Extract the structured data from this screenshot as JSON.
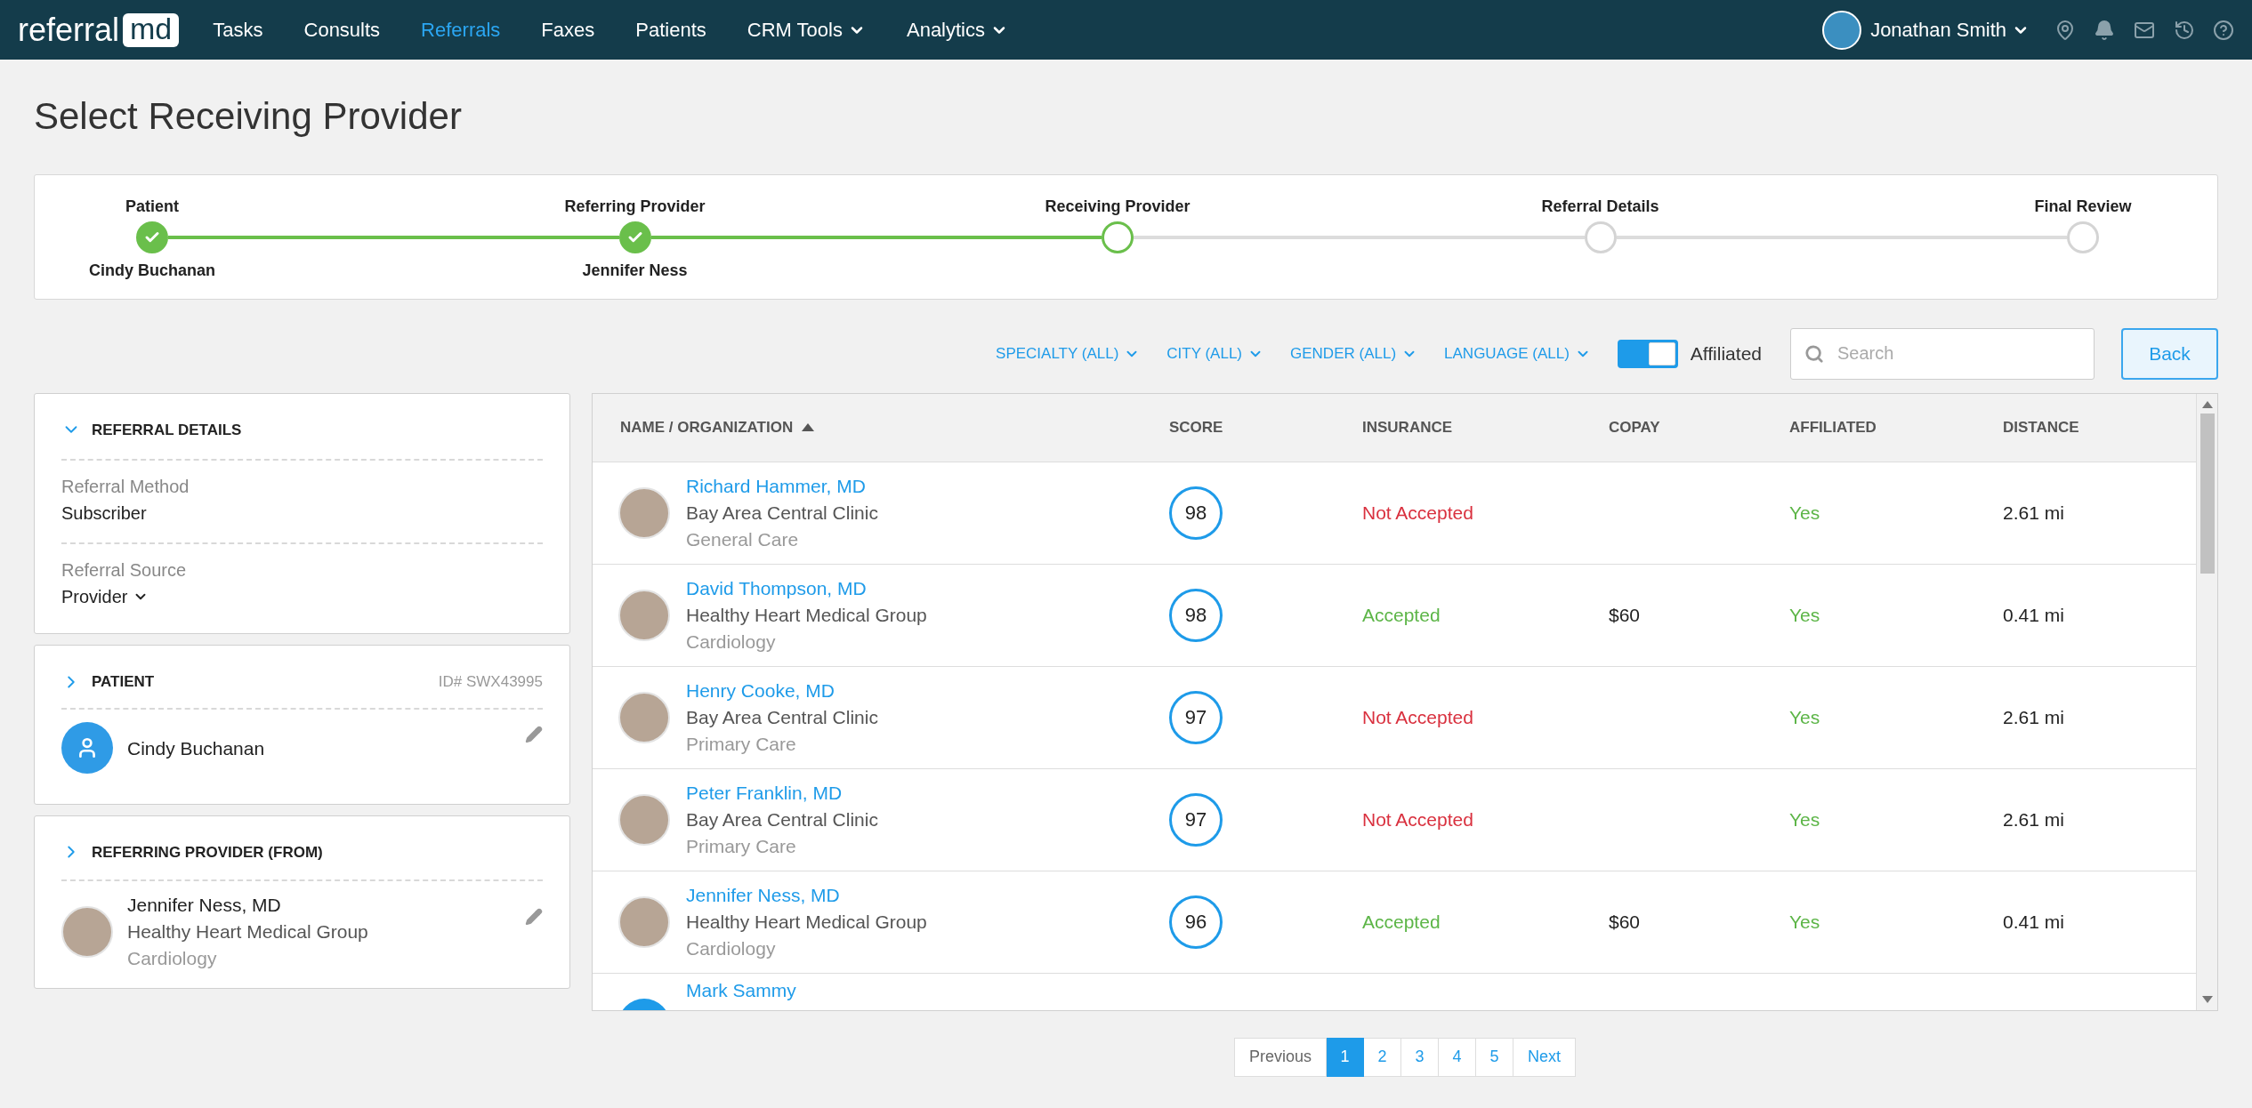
{
  "nav": {
    "logo_left": "referral",
    "logo_right": "md",
    "items": [
      {
        "label": "Tasks",
        "selected": false,
        "kind": "link"
      },
      {
        "label": "Consults",
        "selected": false,
        "kind": "link"
      },
      {
        "label": "Referrals",
        "selected": true,
        "kind": "link"
      },
      {
        "label": "Faxes",
        "selected": false,
        "kind": "link"
      },
      {
        "label": "Patients",
        "selected": false,
        "kind": "link"
      },
      {
        "label": "CRM Tools",
        "selected": false,
        "kind": "dropdown"
      },
      {
        "label": "Analytics",
        "selected": false,
        "kind": "dropdown"
      }
    ],
    "user": "Jonathan Smith"
  },
  "page_title": "Select Receiving Provider",
  "steps": [
    {
      "label": "Patient",
      "value": "Cindy Buchanan",
      "done": true,
      "current": false
    },
    {
      "label": "Referring Provider",
      "value": "Jennifer Ness",
      "done": true,
      "current": false
    },
    {
      "label": "Receiving Provider",
      "done": false,
      "current": true
    },
    {
      "label": "Referral Details",
      "done": false,
      "current": false
    },
    {
      "label": "Final Review",
      "done": false,
      "current": false
    }
  ],
  "filters": [
    "SPECIALTY (ALL)",
    "CITY (ALL)",
    "GENDER (ALL)",
    "LANGUAGE (ALL)"
  ],
  "affiliated_toggle": {
    "label": "Affiliated",
    "on": true
  },
  "search": {
    "placeholder": "Search"
  },
  "back_button": "Back",
  "referral_details": {
    "title": "REFERRAL DETAILS",
    "expanded": true,
    "fields": [
      {
        "label": "Referral Method",
        "value": "Subscriber",
        "kind": "text"
      },
      {
        "label": "Referral Source",
        "value": "Provider",
        "kind": "dropdown"
      }
    ]
  },
  "patient": {
    "title": "PATIENT",
    "expanded": false,
    "id": "ID# SWX43995",
    "name": "Cindy Buchanan"
  },
  "referring_provider": {
    "title": "REFERRING PROVIDER (FROM)",
    "expanded": false,
    "name": "Jennifer Ness, MD",
    "organization": "Healthy Heart Medical Group",
    "specialty": "Cardiology"
  },
  "table": {
    "columns": [
      {
        "label": "NAME / ORGANIZATION",
        "sorted": true
      },
      {
        "label": "SCORE",
        "sorted": false
      },
      {
        "label": "INSURANCE",
        "sorted": false
      },
      {
        "label": "COPAY",
        "sorted": false
      },
      {
        "label": "AFFILIATED",
        "sorted": false
      },
      {
        "label": "DISTANCE",
        "sorted": false
      }
    ],
    "rows": [
      {
        "generic_avatar": false,
        "name": "Richard Hammer, MD",
        "organization": "Bay Area Central Clinic",
        "specialty": "General Care",
        "score": "98",
        "insurance": "Not Accepted",
        "insurance_accepted": false,
        "affiliated": "Yes",
        "distance": "2.61 mi"
      },
      {
        "generic_avatar": false,
        "name": "David Thompson, MD",
        "organization": "Healthy Heart Medical Group",
        "specialty": "Cardiology",
        "score": "98",
        "insurance": "Accepted",
        "insurance_accepted": true,
        "copay": "$60",
        "affiliated": "Yes",
        "distance": "0.41 mi"
      },
      {
        "generic_avatar": false,
        "name": "Henry Cooke, MD",
        "organization": "Bay Area Central Clinic",
        "specialty": "Primary Care",
        "score": "97",
        "insurance": "Not Accepted",
        "insurance_accepted": false,
        "affiliated": "Yes",
        "distance": "2.61 mi"
      },
      {
        "generic_avatar": false,
        "name": "Peter Franklin, MD",
        "organization": "Bay Area Central Clinic",
        "specialty": "Primary Care",
        "score": "97",
        "insurance": "Not Accepted",
        "insurance_accepted": false,
        "affiliated": "Yes",
        "distance": "2.61 mi"
      },
      {
        "generic_avatar": false,
        "name": "Jennifer Ness, MD",
        "organization": "Healthy Heart Medical Group",
        "specialty": "Cardiology",
        "score": "96",
        "insurance": "Accepted",
        "insurance_accepted": true,
        "copay": "$60",
        "affiliated": "Yes",
        "distance": "0.41 mi"
      },
      {
        "generic_avatar": true,
        "name": "Mark Sammy"
      }
    ]
  },
  "pagination": {
    "previous": "Previous",
    "pages": [
      {
        "label": "1",
        "selected": true
      },
      {
        "label": "2",
        "selected": false
      },
      {
        "label": "3",
        "selected": false
      },
      {
        "label": "4",
        "selected": false
      },
      {
        "label": "5",
        "selected": false
      }
    ],
    "next": "Next"
  }
}
